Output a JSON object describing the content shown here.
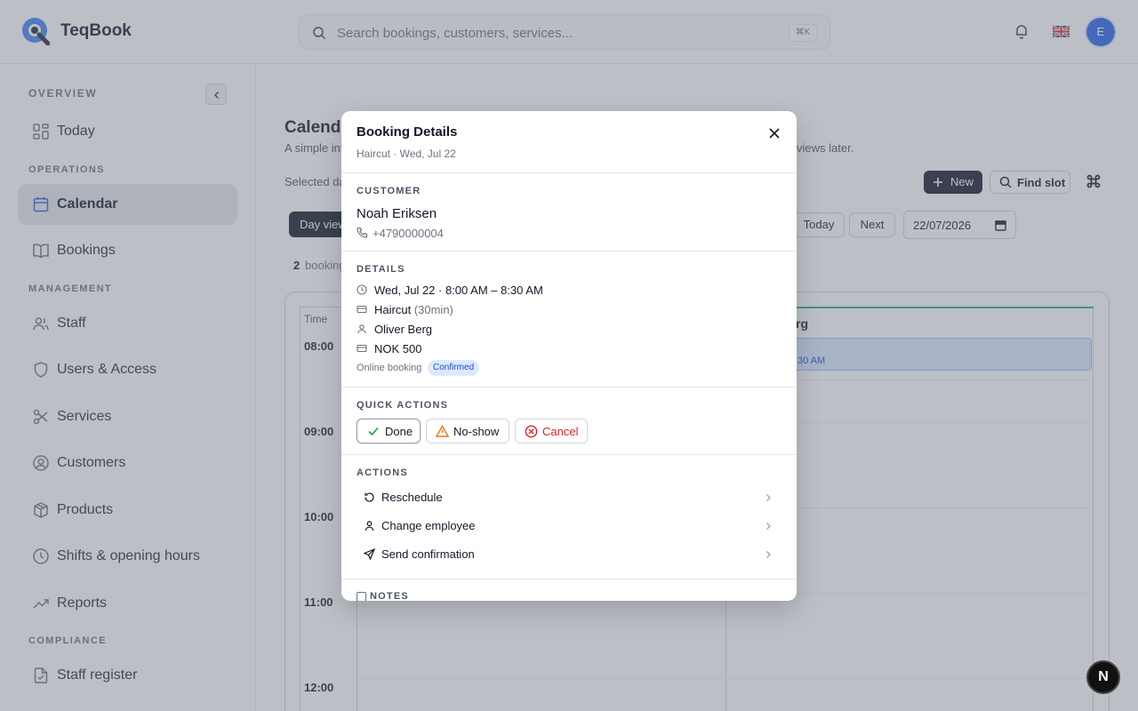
{
  "app": {
    "name": "TeqBook",
    "search_placeholder": "Search bookings, customers, services...",
    "search_shortcut": "⌘K",
    "avatar_initial": "E",
    "language_flag": "uk-flag-icon"
  },
  "sidebar": {
    "overview_label": "OVERVIEW",
    "operations_label": "OPERATIONS",
    "management_label": "MANAGEMENT",
    "compliance_label": "COMPLIANCE",
    "items": [
      {
        "label": "Today",
        "icon": "dashboard-icon"
      },
      {
        "label": "Calendar",
        "icon": "calendar-icon",
        "active": true
      },
      {
        "label": "Bookings",
        "icon": "book-icon"
      },
      {
        "label": "Staff",
        "icon": "users-icon"
      },
      {
        "label": "Users & Access",
        "icon": "shield-icon"
      },
      {
        "label": "Services",
        "icon": "scissors-icon"
      },
      {
        "label": "Customers",
        "icon": "user-circle-icon"
      },
      {
        "label": "Products",
        "icon": "package-icon"
      },
      {
        "label": "Shifts & opening hours",
        "icon": "clock-icon"
      },
      {
        "label": "Reports",
        "icon": "trending-up-icon"
      },
      {
        "label": "Staff register",
        "icon": "file-check-icon"
      }
    ]
  },
  "page": {
    "title": "Calenda",
    "subtitle_start": "A simple int",
    "subtitle_end": "views later.",
    "selected_label": "Selected da",
    "new_button": "New",
    "find_slot_button": "Find slot",
    "day_view_button": "Day view",
    "today_button": "Today",
    "next_button": "Next",
    "date_value": "22/07/2026",
    "bookings_count": "2",
    "bookings_label": "booking",
    "time_header": "Time",
    "staff_name": "rg",
    "booking_block_time": "30 AM",
    "hours": [
      "08:00",
      "09:00",
      "10:00",
      "11:00",
      "12:00"
    ]
  },
  "modal": {
    "title": "Booking Details",
    "subtitle": "Haircut · Wed, Jul 22",
    "customer_section": "CUSTOMER",
    "customer_name": "Noah Eriksen",
    "customer_phone": "+4790000004",
    "details_section": "DETAILS",
    "datetime": "Wed, Jul 22 · 8:00 AM – 8:30 AM",
    "service": "Haircut",
    "duration": "(30min)",
    "employee": "Oliver Berg",
    "price": "NOK 500",
    "source": "Online booking",
    "status": "Confirmed",
    "quick_actions_section": "QUICK ACTIONS",
    "done_label": "Done",
    "noshow_label": "No-show",
    "cancel_label": "Cancel",
    "actions_section": "ACTIONS",
    "reschedule_label": "Reschedule",
    "change_employee_label": "Change employee",
    "send_confirmation_label": "Send confirmation",
    "notes_section": "NOTES"
  },
  "fab_label": "N",
  "colors": {
    "accent": "#2563eb",
    "primary_dark": "#111827",
    "status_confirmed_bg": "#dbeafe",
    "status_confirmed_text": "#1d4ed8",
    "danger": "#dc2626",
    "warning": "#f97316",
    "success": "#16a34a",
    "staff_accent": "#10b981"
  }
}
